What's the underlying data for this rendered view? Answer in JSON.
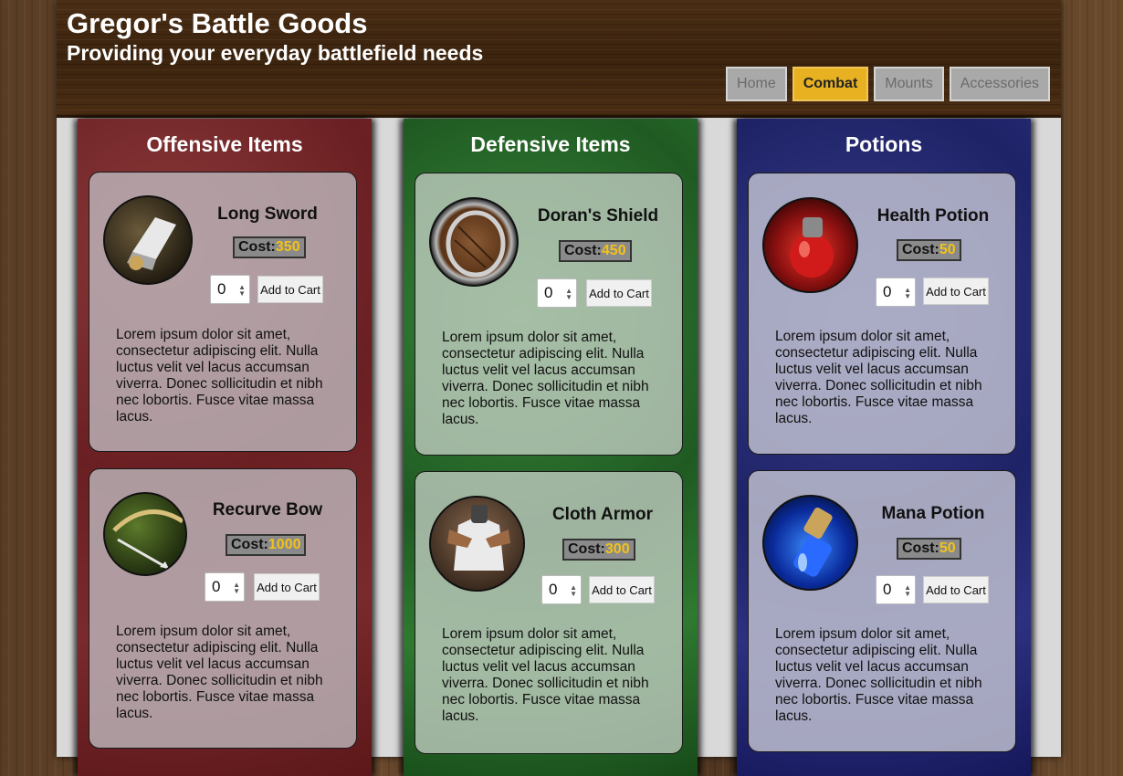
{
  "header": {
    "title": "Gregor's Battle Goods",
    "subtitle": "Providing your everyday battlefield needs"
  },
  "nav": [
    {
      "label": "Home",
      "active": false
    },
    {
      "label": "Combat",
      "active": true
    },
    {
      "label": "Mounts",
      "active": false
    },
    {
      "label": "Accessories",
      "active": false
    }
  ],
  "columns": [
    {
      "title": "Offensive Items",
      "items": [
        {
          "name": "Long Sword",
          "cost_label": "Cost:",
          "cost": "350",
          "qty": "0",
          "button": "Add to Cart",
          "icon": "sword-icon",
          "desc": "Lorem ipsum dolor sit amet, consectetur adipiscing elit. Nulla luctus velit vel lacus accumsan viverra. Donec sollicitudin et nibh nec lobortis. Fusce vitae massa lacus."
        },
        {
          "name": "Recurve Bow",
          "cost_label": "Cost:",
          "cost": "1000",
          "qty": "0",
          "button": "Add to Cart",
          "icon": "bow-icon",
          "desc": "Lorem ipsum dolor sit amet, consectetur adipiscing elit. Nulla luctus velit vel lacus accumsan viverra. Donec sollicitudin et nibh nec lobortis. Fusce vitae massa lacus."
        }
      ]
    },
    {
      "title": "Defensive Items",
      "items": [
        {
          "name": "Doran's Shield",
          "cost_label": "Cost:",
          "cost": "450",
          "qty": "0",
          "button": "Add to Cart",
          "icon": "shield-icon",
          "desc": "Lorem ipsum dolor sit amet, consectetur adipiscing elit. Nulla luctus velit vel lacus accumsan viverra. Donec sollicitudin et nibh nec lobortis. Fusce vitae massa lacus."
        },
        {
          "name": "Cloth Armor",
          "cost_label": "Cost:",
          "cost": "300",
          "qty": "0",
          "button": "Add to Cart",
          "icon": "armor-icon",
          "desc": "Lorem ipsum dolor sit amet, consectetur adipiscing elit. Nulla luctus velit vel lacus accumsan viverra. Donec sollicitudin et nibh nec lobortis. Fusce vitae massa lacus."
        }
      ]
    },
    {
      "title": "Potions",
      "items": [
        {
          "name": "Health Potion",
          "cost_label": "Cost: ",
          "cost": "50",
          "qty": "0",
          "button": "Add to Cart",
          "icon": "health-potion-icon",
          "desc": "Lorem ipsum dolor sit amet, consectetur adipiscing elit. Nulla luctus velit vel lacus accumsan viverra. Donec sollicitudin et nibh nec lobortis. Fusce vitae massa lacus."
        },
        {
          "name": "Mana Potion",
          "cost_label": "Cost: ",
          "cost": "50",
          "qty": "0",
          "button": "Add to Cart",
          "icon": "mana-potion-icon",
          "desc": "Lorem ipsum dolor sit amet, consectetur adipiscing elit. Nulla luctus velit vel lacus accumsan viverra. Donec sollicitudin et nibh nec lobortis. Fusce vitae massa lacus."
        }
      ]
    }
  ]
}
